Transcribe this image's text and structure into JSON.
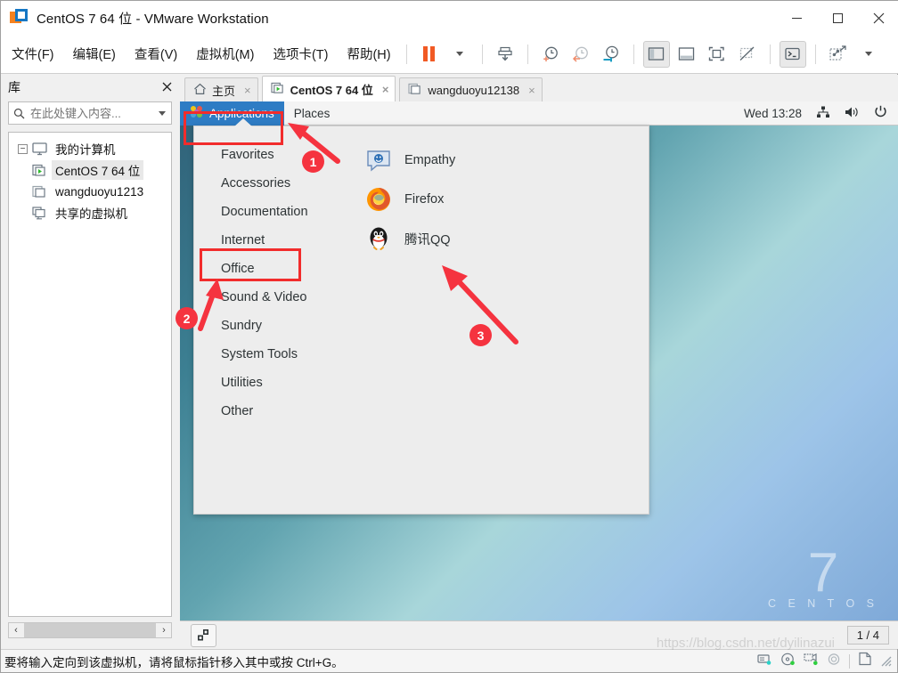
{
  "window": {
    "title": "CentOS 7 64 位 - VMware Workstation",
    "logo_icon": "vmware-logo-icon",
    "minimize_label": "最小化",
    "maximize_label": "最大化",
    "close_label": "关闭"
  },
  "menubar": {
    "items": [
      {
        "label": "文件(F)",
        "name": "menu-file"
      },
      {
        "label": "编辑(E)",
        "name": "menu-edit"
      },
      {
        "label": "查看(V)",
        "name": "menu-view"
      },
      {
        "label": "虚拟机(M)",
        "name": "menu-vm"
      },
      {
        "label": "选项卡(T)",
        "name": "menu-tabs"
      },
      {
        "label": "帮助(H)",
        "name": "menu-help"
      }
    ],
    "toolbar": [
      {
        "name": "suspend-button",
        "icon": "pause-icon"
      },
      {
        "name": "power-dropdown",
        "icon": "chevron-down-icon"
      },
      {
        "name": "send-ctrl-alt-del-button",
        "icon": "send-keys-icon"
      },
      {
        "name": "snapshot-take-button",
        "icon": "clock-plus-icon"
      },
      {
        "name": "snapshot-revert-button",
        "icon": "clock-back-icon"
      },
      {
        "name": "snapshot-manager-button",
        "icon": "clock-wrench-icon"
      },
      {
        "name": "show-library-button",
        "icon": "left-pane-icon"
      },
      {
        "name": "show-thumbnails-button",
        "icon": "bottom-pane-icon"
      },
      {
        "name": "fullscreen-button",
        "icon": "fullscreen-icon"
      },
      {
        "name": "unity-mode-button",
        "icon": "unity-icon"
      },
      {
        "name": "console-view-button",
        "icon": "terminal-icon"
      },
      {
        "name": "stretch-guest-button",
        "icon": "stretch-icon"
      },
      {
        "name": "stretch-dropdown",
        "icon": "chevron-down-icon"
      }
    ]
  },
  "library": {
    "title": "库",
    "close_icon": "close-icon",
    "search": {
      "placeholder": "在此处键入内容...",
      "value": "",
      "icon": "search-icon",
      "dropdown_icon": "chevron-down-icon"
    },
    "tree": [
      {
        "label": "我的计算机",
        "icon": "my-computer-icon",
        "level": 0,
        "expander": "−",
        "selected": false
      },
      {
        "label": "CentOS 7 64 位",
        "icon": "vm-running-icon",
        "level": 1,
        "selected": true
      },
      {
        "label": "wangduoyu1213",
        "icon": "vm-stopped-icon",
        "level": 1,
        "selected": false
      },
      {
        "label": "共享的虚拟机",
        "icon": "shared-vms-icon",
        "level": 0,
        "selected": false
      }
    ],
    "scroll": {
      "left_arrow": "‹",
      "right_arrow": "›"
    }
  },
  "tabs": [
    {
      "label": "主页",
      "icon": "home-icon",
      "active": false,
      "close_icon": "×"
    },
    {
      "label": "CentOS 7 64 位",
      "icon": "vm-running-icon",
      "active": true,
      "close_icon": "×"
    },
    {
      "label": "wangduoyu12138",
      "icon": "vm-stopped-icon",
      "active": false,
      "close_icon": "×"
    }
  ],
  "guest": {
    "panel": {
      "applications_label": "Applications",
      "applications_icon": "gnome-foot-icon",
      "places_label": "Places",
      "clock": "Wed 13:28",
      "tray": [
        {
          "name": "network-icon",
          "label": "网络"
        },
        {
          "name": "volume-icon",
          "label": "音量"
        },
        {
          "name": "power-icon",
          "label": "电源"
        }
      ]
    },
    "app_menu": {
      "categories": [
        "Favorites",
        "Accessories",
        "Documentation",
        "Internet",
        "Office",
        "Sound & Video",
        "Sundry",
        "System Tools",
        "Utilities",
        "Other"
      ],
      "selected_category": "Internet",
      "applications": [
        {
          "label": "Empathy",
          "icon": "empathy-icon"
        },
        {
          "label": "Firefox",
          "icon": "firefox-icon"
        },
        {
          "label": "腾讯QQ",
          "icon": "qq-penguin-icon"
        }
      ]
    },
    "wallpaper": {
      "brand_number": "7",
      "brand_name": "C E N T O S"
    }
  },
  "vm_statusbar": {
    "unity_button_icon": "restore-windows-icon",
    "page_indicator": "1 / 4"
  },
  "statusbar": {
    "message": "要将输入定向到该虚拟机，请将鼠标指针移入其中或按 Ctrl+G。",
    "icons": [
      {
        "name": "hard-disk-status-icon"
      },
      {
        "name": "cd-dvd-status-icon"
      },
      {
        "name": "network-status-icon"
      },
      {
        "name": "usb-status-icon"
      },
      {
        "name": "printer-status-icon"
      },
      {
        "name": "resize-grip-icon"
      }
    ]
  },
  "watermark": "https://blog.csdn.net/dyilinazui",
  "annotations": {
    "accent_color": "#f5333f",
    "markers": [
      {
        "number": "1",
        "target": "applications-menu"
      },
      {
        "number": "2",
        "target": "internet-category"
      },
      {
        "number": "3",
        "target": "tencent-qq-app"
      }
    ],
    "boxes": [
      {
        "target": "applications-button"
      },
      {
        "target": "internet-category"
      }
    ]
  }
}
